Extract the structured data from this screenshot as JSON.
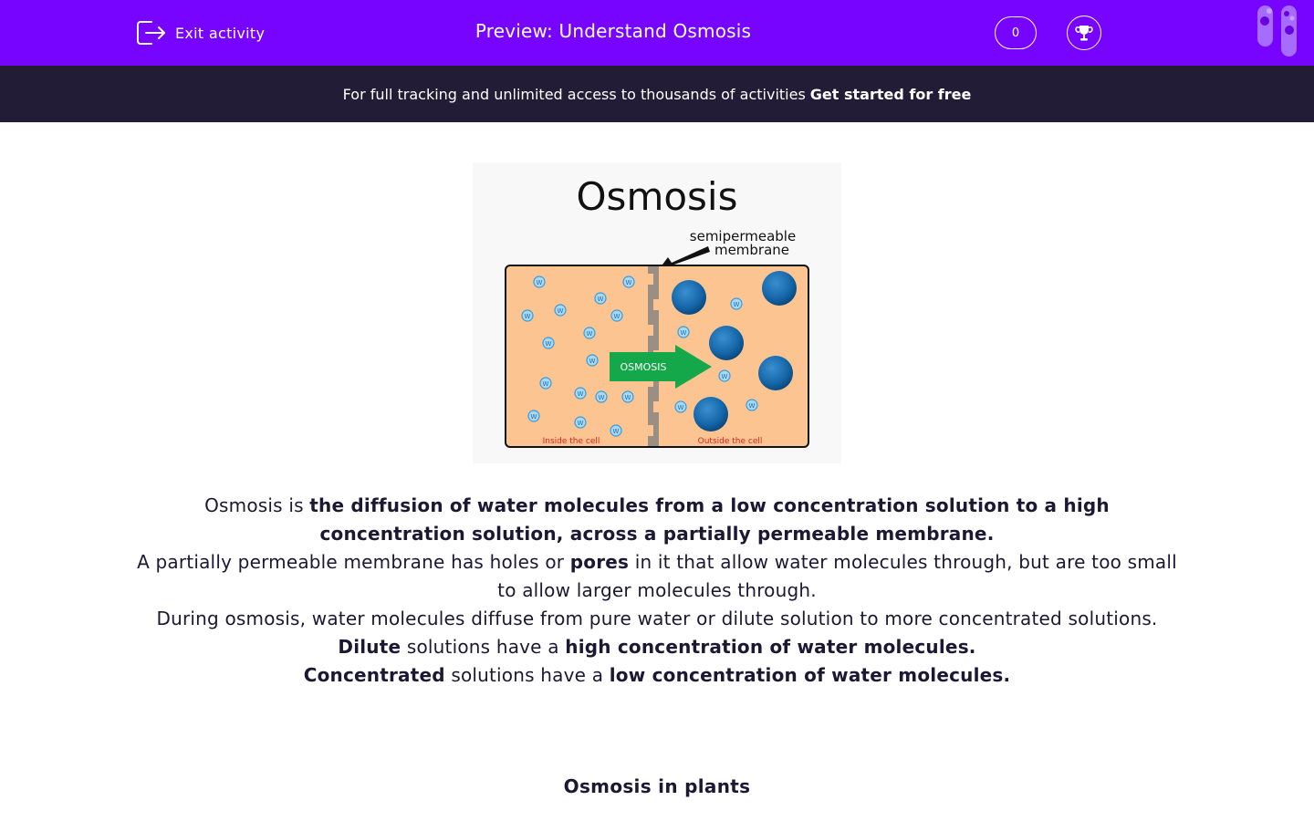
{
  "header": {
    "exit_label": "Exit activity",
    "title": "Preview: Understand Osmosis",
    "score": "0",
    "bg_color": "#7604ff"
  },
  "promo": {
    "text": "For full tracking and unlimited access to thousands of activities",
    "cta": "Get started for free"
  },
  "figure": {
    "title": "Osmosis",
    "membrane_label_line1": "semipermeable",
    "membrane_label_line2": "membrane",
    "arrow_label": "OSMOSIS",
    "left_label": "Inside the cell",
    "right_label": "Outside the cell",
    "water_symbol": "W"
  },
  "body": {
    "p1_pre": "Osmosis is ",
    "p1_bold": "the diffusion of water molecules from a low concentration solution to a high concentration solution, across a partially permeable membrane.",
    "p2_pre": "A partially permeable membrane has holes or ",
    "p2_bold": "pores",
    "p2_post": " in it that allow water molecules through, but are too small to allow larger molecules through.",
    "p3": "During osmosis, water molecules diffuse from pure water or dilute solution to more concentrated solutions.",
    "p4_bold1": "Dilute",
    "p4_mid": " solutions have a ",
    "p4_bold2": "high concentration of water molecules.",
    "p5_bold1": "Concentrated",
    "p5_mid": " solutions have a ",
    "p5_bold2": "low concentration of water molecules."
  },
  "subheading": "Osmosis in plants"
}
